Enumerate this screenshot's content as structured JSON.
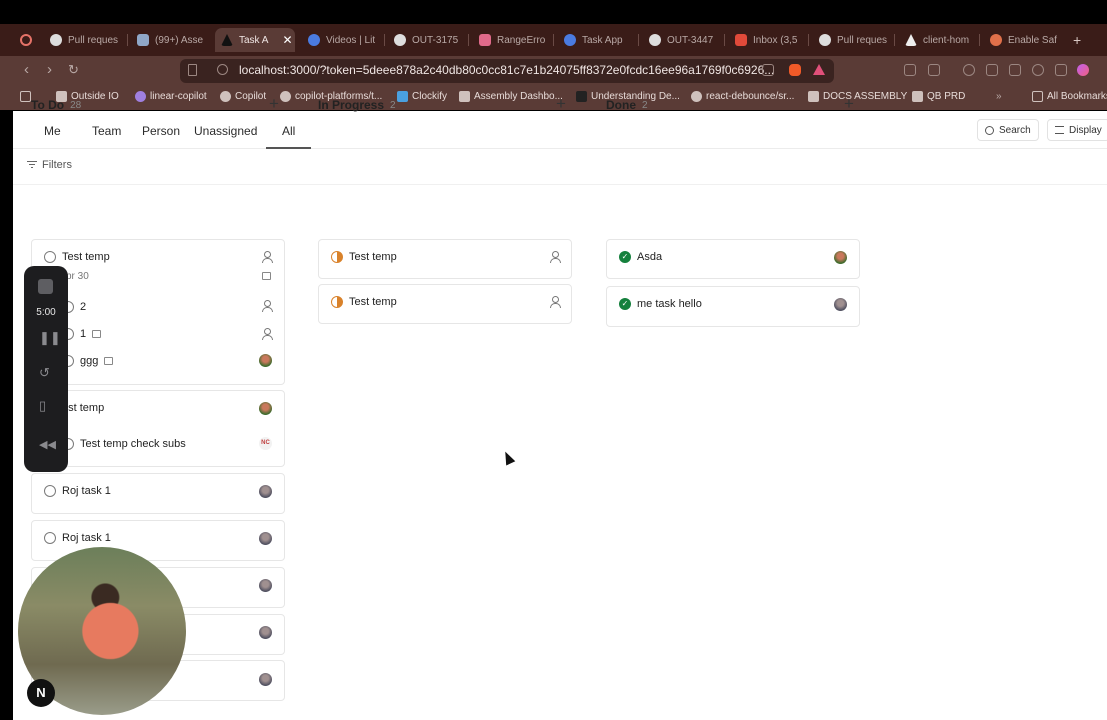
{
  "browser": {
    "tabs": [
      {
        "label": "Pull reques",
        "icon": "github-icon"
      },
      {
        "label": "(99+) Asse",
        "icon": "assembly-icon"
      },
      {
        "label": "Task A",
        "icon": "triangle-icon",
        "active": true
      },
      {
        "label": "Videos | Lit",
        "icon": "loom-icon"
      },
      {
        "label": "OUT-3175",
        "icon": "linear-icon"
      },
      {
        "label": "RangeErro",
        "icon": "sentry-icon"
      },
      {
        "label": "Task App",
        "icon": "loom-icon"
      },
      {
        "label": "OUT-3447",
        "icon": "github-icon"
      },
      {
        "label": "Inbox (3,5",
        "icon": "gmail-icon"
      },
      {
        "label": "Pull reques",
        "icon": "github-icon"
      },
      {
        "label": "client-hom",
        "icon": "triangle-icon"
      },
      {
        "label": "Enable Saf",
        "icon": "claude-icon"
      }
    ],
    "url": "localhost:3000/?token=5deee878a2c40db80c0cc81c7e1b24075ff8372e0fcdc16ee96a1769f0c6926...",
    "bookmarks": [
      "Outside IO",
      "linear-copilot",
      "Copilot",
      "copilot-platforms/t...",
      "Clockify",
      "Assembly Dashbo...",
      "Understanding De...",
      "react-debounce/sr...",
      "DOCS ASSEMBLY",
      "QB PRD",
      "All Bookmarks"
    ],
    "more_bookmarks": "»"
  },
  "app": {
    "nav_tabs": [
      "Me",
      "Team",
      "Person",
      "Unassigned",
      "All"
    ],
    "search_label": "Search",
    "display_label": "Display",
    "filters_label": "Filters"
  },
  "columns": {
    "todo": {
      "title": "To Do",
      "count": "28"
    },
    "inprogress": {
      "title": "In Progress",
      "count": "2"
    },
    "done": {
      "title": "Done",
      "count": "2"
    }
  },
  "todo_cards": {
    "c1_title": "Test temp",
    "c1_date": "pr 30",
    "c1_sub1": "2",
    "c1_sub2": "1",
    "c1_sub3": "ggg",
    "c2_title": "est temp",
    "c2_sub1": "Test temp check subs",
    "c2_sub1_avatar": "NC",
    "c3_title": "Roj task 1",
    "c4_title": "Roj task 1"
  },
  "inprogress_cards": [
    "Test temp",
    "Test temp"
  ],
  "done_cards": [
    "Asda",
    "me task hello"
  ],
  "recorder": {
    "time": "5:00"
  },
  "badge": {
    "letter": "N"
  }
}
